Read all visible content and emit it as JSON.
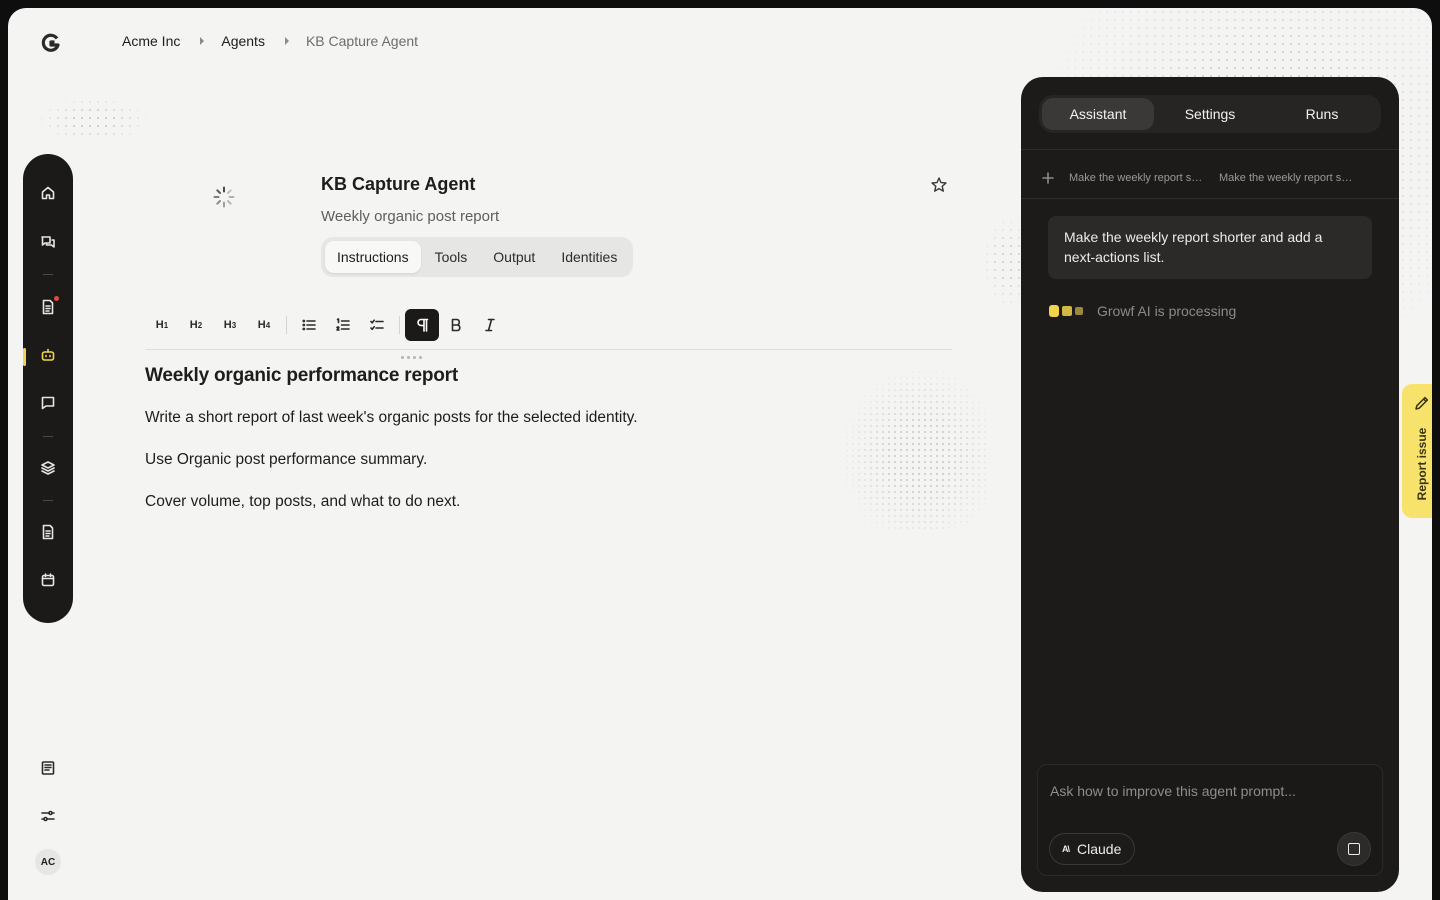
{
  "breadcrumb": [
    "Acme Inc",
    "Agents",
    "KB Capture Agent"
  ],
  "rail": {
    "items": [
      "home-icon",
      "chat-bubbles-icon",
      "document-icon",
      "robot-icon",
      "message-icon",
      "layers-icon",
      "file-icon",
      "calendar-icon"
    ],
    "active": "robot-icon",
    "notification_on": "document-icon"
  },
  "bottom": {
    "items": [
      "book-icon",
      "sliders-icon"
    ],
    "avatar_initials": "AC"
  },
  "agent": {
    "title": "KB Capture Agent",
    "subtitle": "Weekly organic post report",
    "tabs": [
      "Instructions",
      "Tools",
      "Output",
      "Identities"
    ],
    "active_tab": "Instructions"
  },
  "toolbar": {
    "headings": [
      {
        "letter": "H",
        "level": "1"
      },
      {
        "letter": "H",
        "level": "2"
      },
      {
        "letter": "H",
        "level": "3"
      },
      {
        "letter": "H",
        "level": "4"
      }
    ],
    "list_icons": [
      "bullet-list-icon",
      "numbered-list-icon",
      "checklist-icon"
    ],
    "format_icons": [
      "paragraph-icon",
      "bold-icon",
      "italic-icon"
    ],
    "active": "paragraph-icon"
  },
  "document": {
    "heading": "Weekly organic performance report",
    "paragraphs": [
      "Write a short report of last week's organic posts for the selected identity.",
      "Use Organic post performance summary.",
      "Cover volume, top posts, and what to do next."
    ]
  },
  "assistant": {
    "tabs": [
      "Assistant",
      "Settings",
      "Runs"
    ],
    "active_tab": "Assistant",
    "threads": [
      "Make the weekly report shorter and add a next-actions list.",
      "Make the weekly report shorter and add a next-actions list."
    ],
    "message": "Make the weekly report shorter and add a next-actions list.",
    "status": "Growf AI is processing",
    "composer_placeholder": "Ask how to improve this agent prompt...",
    "model": "Claude",
    "model_icon_text": "A\\"
  },
  "report_issue": "Report issue",
  "colors": {
    "accent": "#f2d44c",
    "panel": "#1c1b1a",
    "report": "#f7e36b",
    "notification": "#e5483e"
  }
}
